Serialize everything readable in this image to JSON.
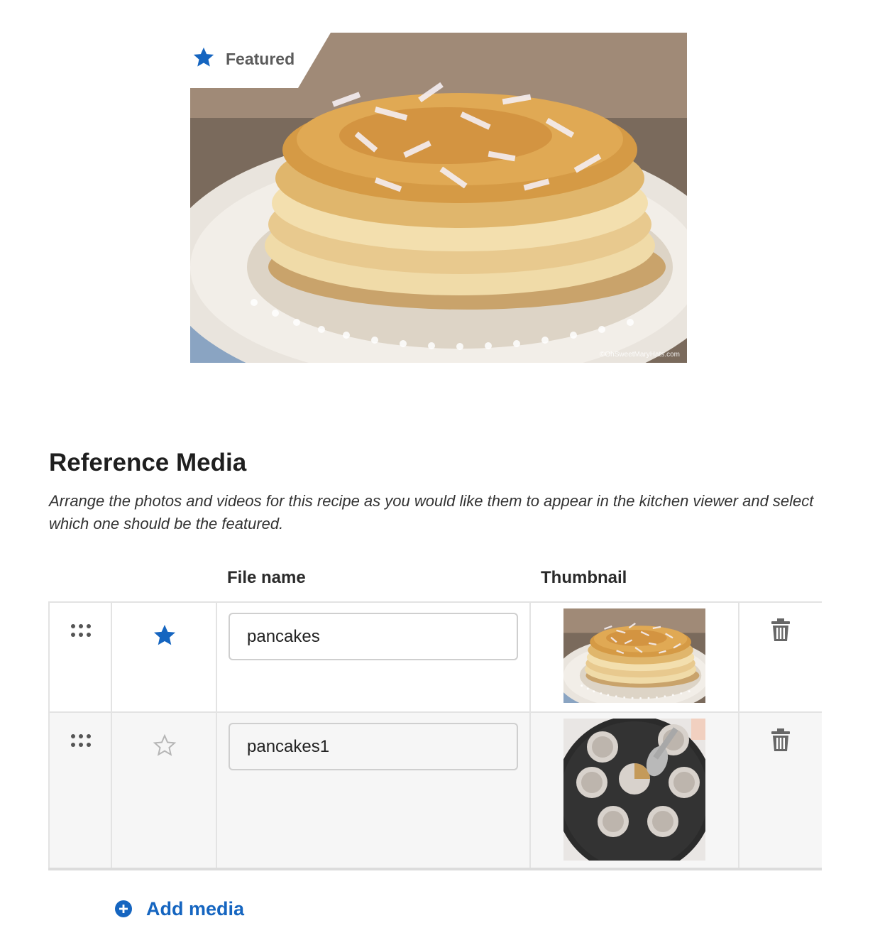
{
  "featured": {
    "label": "Featured",
    "image": "pancake stack on white plate with coconut flakes",
    "watermark": "©OhSweetMaryHats.com"
  },
  "section": {
    "title": "Reference Media",
    "description": "Arrange the photos and videos for this recipe as you would like them to appear in the kitchen viewer and select which one should be the featured."
  },
  "table": {
    "headers": {
      "file_name": "File name",
      "thumbnail": "Thumbnail"
    },
    "rows": [
      {
        "file_name": "pancakes",
        "featured": true,
        "thumbnail": "pancake stack",
        "star_icon": "star-filled-icon"
      },
      {
        "file_name": "pancakes1",
        "featured": false,
        "thumbnail": "mini pancakes in round pan",
        "star_icon": "star-outline-icon"
      }
    ]
  },
  "add_media": {
    "label": "Add media"
  },
  "colors": {
    "accent": "#1565c0",
    "icon_gray": "#666666",
    "border": "#e3e3e3",
    "row_alt": "#f6f6f6"
  }
}
